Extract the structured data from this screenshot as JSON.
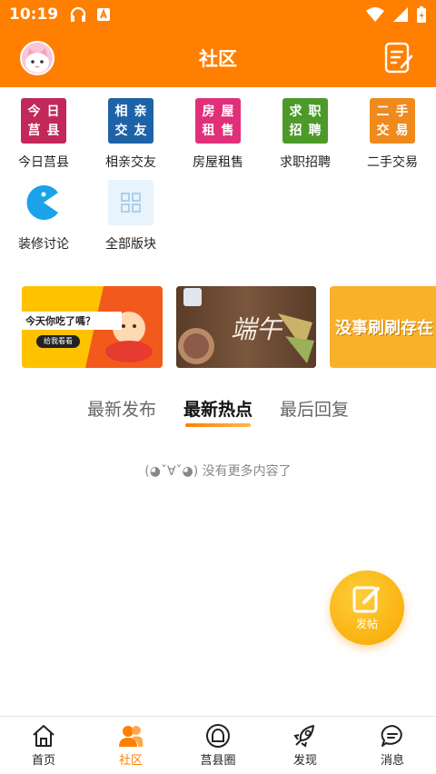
{
  "status_bar": {
    "time": "10:19"
  },
  "header": {
    "title": "社区"
  },
  "categories": [
    {
      "label": "今日莒县",
      "icon_text": [
        "今",
        "日",
        "莒",
        "县"
      ],
      "icon_color": "#c2285a"
    },
    {
      "label": "相亲交友",
      "icon_text": [
        "相",
        "亲",
        "交",
        "友"
      ],
      "icon_color": "#1e63a8"
    },
    {
      "label": "房屋租售",
      "icon_text": [
        "房",
        "屋",
        "租",
        "售"
      ],
      "icon_color": "#e0307a"
    },
    {
      "label": "求职招聘",
      "icon_text": [
        "求",
        "职",
        "招",
        "聘"
      ],
      "icon_color": "#4c9a2a"
    },
    {
      "label": "二手交易",
      "icon_text": [
        "二",
        "手",
        "交",
        "易"
      ],
      "icon_color": "#f08a1c"
    },
    {
      "label": "装修讨论",
      "icon": "pacman-icon",
      "icon_color": "#1aa3e8"
    },
    {
      "label": "全部版块",
      "icon": "grid-icon",
      "icon_color": "#9fc9e8"
    }
  ],
  "banners": [
    {
      "text": "今天你吃了嗎？",
      "button": "给我看看"
    },
    {
      "text": "端午"
    },
    {
      "text": "没事刷刷存在"
    }
  ],
  "tabs": [
    {
      "label": "最新发布",
      "active": false
    },
    {
      "label": "最新热点",
      "active": true
    },
    {
      "label": "最后回复",
      "active": false
    }
  ],
  "empty_text": "(◕ˇ∀ˇ◕) 没有更多内容了",
  "fab": {
    "label": "发帖"
  },
  "bottom_nav": [
    {
      "label": "首页",
      "icon": "home-icon",
      "active": false
    },
    {
      "label": "社区",
      "icon": "community-icon",
      "active": true
    },
    {
      "label": "莒县圈",
      "icon": "circle-icon",
      "active": false
    },
    {
      "label": "发现",
      "icon": "rocket-icon",
      "active": false
    },
    {
      "label": "消息",
      "icon": "chat-icon",
      "active": false
    }
  ],
  "colors": {
    "brand": "#ff7f00",
    "fab": "#f7a600"
  }
}
